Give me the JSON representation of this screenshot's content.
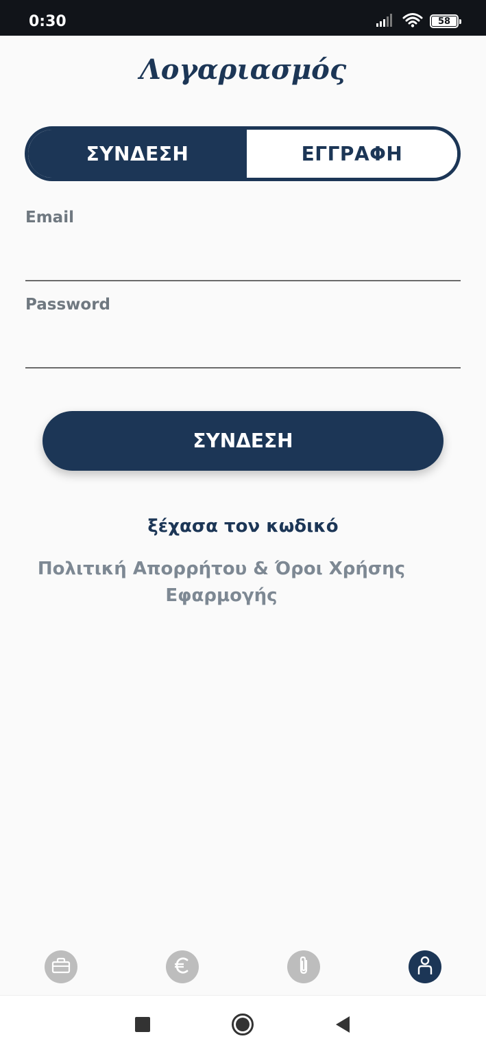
{
  "status_bar": {
    "time": "0:30",
    "battery": "58",
    "icons": [
      "signal-icon",
      "wifi-icon",
      "battery-icon"
    ]
  },
  "header": {
    "title": "Λογαριασμός"
  },
  "tabs": [
    {
      "label": "ΣΥΝΔΕΣΗ",
      "active": true
    },
    {
      "label": "ΕΓΓΡΑΦΗ",
      "active": false
    }
  ],
  "form": {
    "email_label": "Email",
    "email_value": "",
    "password_label": "Password",
    "password_value": "",
    "submit_label": "ΣΥΝΔΕΣΗ"
  },
  "links": {
    "forgot_password": "ξέχασα τον κωδικό",
    "policy_line1": "Πολιτική Απορρήτου & Όροι Χρήσης",
    "policy_line2": "Εφαρμογής"
  },
  "bottom_nav": [
    {
      "icon": "briefcase-icon",
      "active": false
    },
    {
      "icon": "euro-icon",
      "active": false
    },
    {
      "icon": "paperclip-icon",
      "active": false
    },
    {
      "icon": "user-icon",
      "active": true
    }
  ],
  "colors": {
    "primary": "#1c3656",
    "background": "#fafafa",
    "label_gray": "#6f7880",
    "link_gray": "#7d8893",
    "inactive_icon": "#bdbdbd",
    "status_bar": "#111419"
  }
}
